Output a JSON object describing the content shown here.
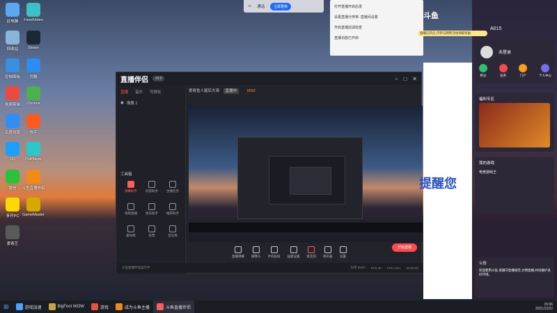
{
  "desktop_icons": [
    {
      "label": "此电脑",
      "color": "#5aa9f0"
    },
    {
      "label": "FixedVideo",
      "color": "#3dc0c6"
    },
    {
      "label": "回收站",
      "color": "#8ab4d8"
    },
    {
      "label": "Steam",
      "color": "#1b2838"
    },
    {
      "label": "控制面板",
      "color": "#3a8fe0"
    },
    {
      "label": "优酷",
      "color": "#2d8cf0"
    },
    {
      "label": "视频剪辑",
      "color": "#e94b3c"
    },
    {
      "label": "Chrome",
      "color": "#4caf50"
    },
    {
      "label": "百度网盘",
      "color": "#2f8ff2"
    },
    {
      "label": "快手",
      "color": "#ff5a1e"
    },
    {
      "label": "QQ",
      "color": "#1aa1ff"
    },
    {
      "label": "PotPlayer",
      "color": "#2ec7c9"
    },
    {
      "label": "微信",
      "color": "#2ac13c"
    },
    {
      "label": "斗鱼直播伴侣",
      "color": "#f28a1a"
    },
    {
      "label": "多开PC",
      "color": "#ffd800"
    },
    {
      "label": "GameMaster",
      "color": "#d4a900"
    },
    {
      "label": "爱奇艺",
      "color": "#5a5a5a"
    }
  ],
  "window": {
    "logo_text": "直播伴侣",
    "version": "v5.0",
    "tabs": [
      "直播",
      "音乐",
      "可视化"
    ],
    "scene_label": "场景 1",
    "tools_header": "工具箱",
    "tools": [
      "弹幕助手",
      "房管助手",
      "主播任务",
      "视频直播",
      "星光助手",
      "推荐助手",
      "素材库",
      "投票",
      "音乐库"
    ],
    "room_title": "爱奇鱼人屋后大清",
    "room_tag": "直播中",
    "viewer_text": "5652",
    "controls": [
      "直播弹幕",
      "摄像头",
      "手机投屏",
      "画面设置",
      "麦克风",
      "扬声器",
      "设置"
    ],
    "start_button": "开始直播",
    "status_left": "斗鱼直播伴侣运行中",
    "status_time": "00:00:00",
    "status_bitrate": "码率 0kb/s",
    "status_fps": "FPS 30",
    "status_cpu": "CPU 12%"
  },
  "notification": {
    "lines": [
      "打开直播开启后发",
      "设置直播分辨率: 直播间设置",
      "开启直播前请检查",
      "直播功能已开启"
    ]
  },
  "top_bar": {
    "label": "通话",
    "refresh": "立即更新"
  },
  "app_window": {
    "cn_text": "提醒您"
  },
  "right_panel": {
    "brand": "斗鱼",
    "id_label": "A015",
    "promo_banner": "直播已开启,可参与网吧活动领取奖励",
    "login_label": "未登录",
    "quick_items": [
      "积分",
      "任务",
      "门户",
      "个人中心"
    ],
    "section_1": "福利专区",
    "section_2": "我的游戏",
    "game_1": "电竞游戏王",
    "section_3": "公告",
    "announce": "欢迎使用斗鱼,请遵守直播规范,文明直播,共同维护良好环境。"
  },
  "taskbar": {
    "items": [
      "游戏加速",
      "BigFoot WOW",
      "游戏",
      "成为斗鱼主播",
      "斗鱼直播伴侣"
    ],
    "time": "15:06",
    "date": "2021/12/22"
  }
}
